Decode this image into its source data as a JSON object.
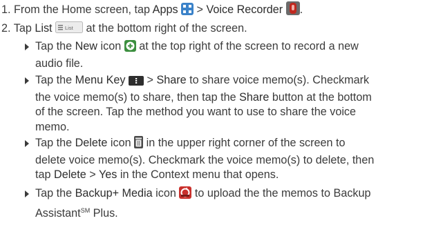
{
  "steps": [
    {
      "num": "1.",
      "t1": "From the Home screen, tap ",
      "k1": "Apps",
      "t2": " > ",
      "k2": "Voice Recorder",
      "t3": "."
    },
    {
      "num": "2.",
      "t1": "Tap ",
      "k1": "List",
      "list_icon_label": "List",
      "t2": " at the bottom right of the screen."
    }
  ],
  "bullets": [
    {
      "t1": "Tap the ",
      "k1": "New",
      "t2": " icon ",
      "t3": " at the top right of the screen to record a new",
      "line2": "audio file."
    },
    {
      "t1": "Tap the ",
      "k1": "Menu Key",
      "t2": " > ",
      "k2": "Share",
      "t3": " to share voice memo(s). Checkmark",
      "line2a": "the voice memo(s) to share, then tap the ",
      "k3": "Share",
      "line2b": " button at the bottom",
      "line3": "of the screen. Tap the method you want to use to share the voice",
      "line4": "memo."
    },
    {
      "t1": "Tap the ",
      "k1": "Delete",
      "t2": " icon ",
      "t3": " in the upper right corner of the screen to",
      "line2": "delete voice memo(s). Checkmark the voice memo(s) to delete, then",
      "line3a": "tap ",
      "k2": "Delete",
      "line3b": " > ",
      "k3": "Yes",
      "line3c": " in the Context menu that opens."
    },
    {
      "t1": "Tap the ",
      "k1": "Backup+ Media",
      "t2": " icon ",
      "t3": " to upload the the memos to Backup",
      "line2a": "Assistant",
      "sup": "SM",
      "line2b": " Plus."
    }
  ],
  "icons": {
    "apps": "apps-grid-icon",
    "recorder": "voice-recorder-icon",
    "list": "list-icon",
    "new": "new-plus-icon",
    "menu": "menu-key-icon",
    "delete": "trash-icon",
    "backup": "backup-media-icon"
  }
}
